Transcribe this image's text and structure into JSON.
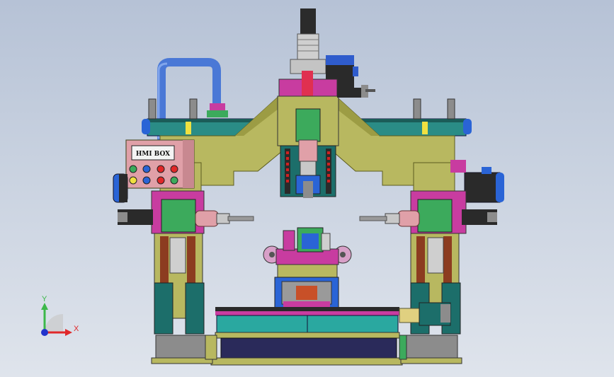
{
  "viewport": {
    "hmi_box_label": "HMI BOX"
  },
  "triad": {
    "y_label": "Y",
    "x_label": "X",
    "y_color": "#3cb84a",
    "x_color": "#e0282a",
    "z_color": "#2233cc"
  },
  "colors": {
    "frame": "#b8b860",
    "frame_dark": "#8c8c3c",
    "teal": "#1f8a8a",
    "green": "#3caa5c",
    "magenta": "#c83ca0",
    "blue": "#2a64d6",
    "dark": "#222222",
    "pink": "#e0a0a8",
    "gray": "#8c8c8c"
  }
}
